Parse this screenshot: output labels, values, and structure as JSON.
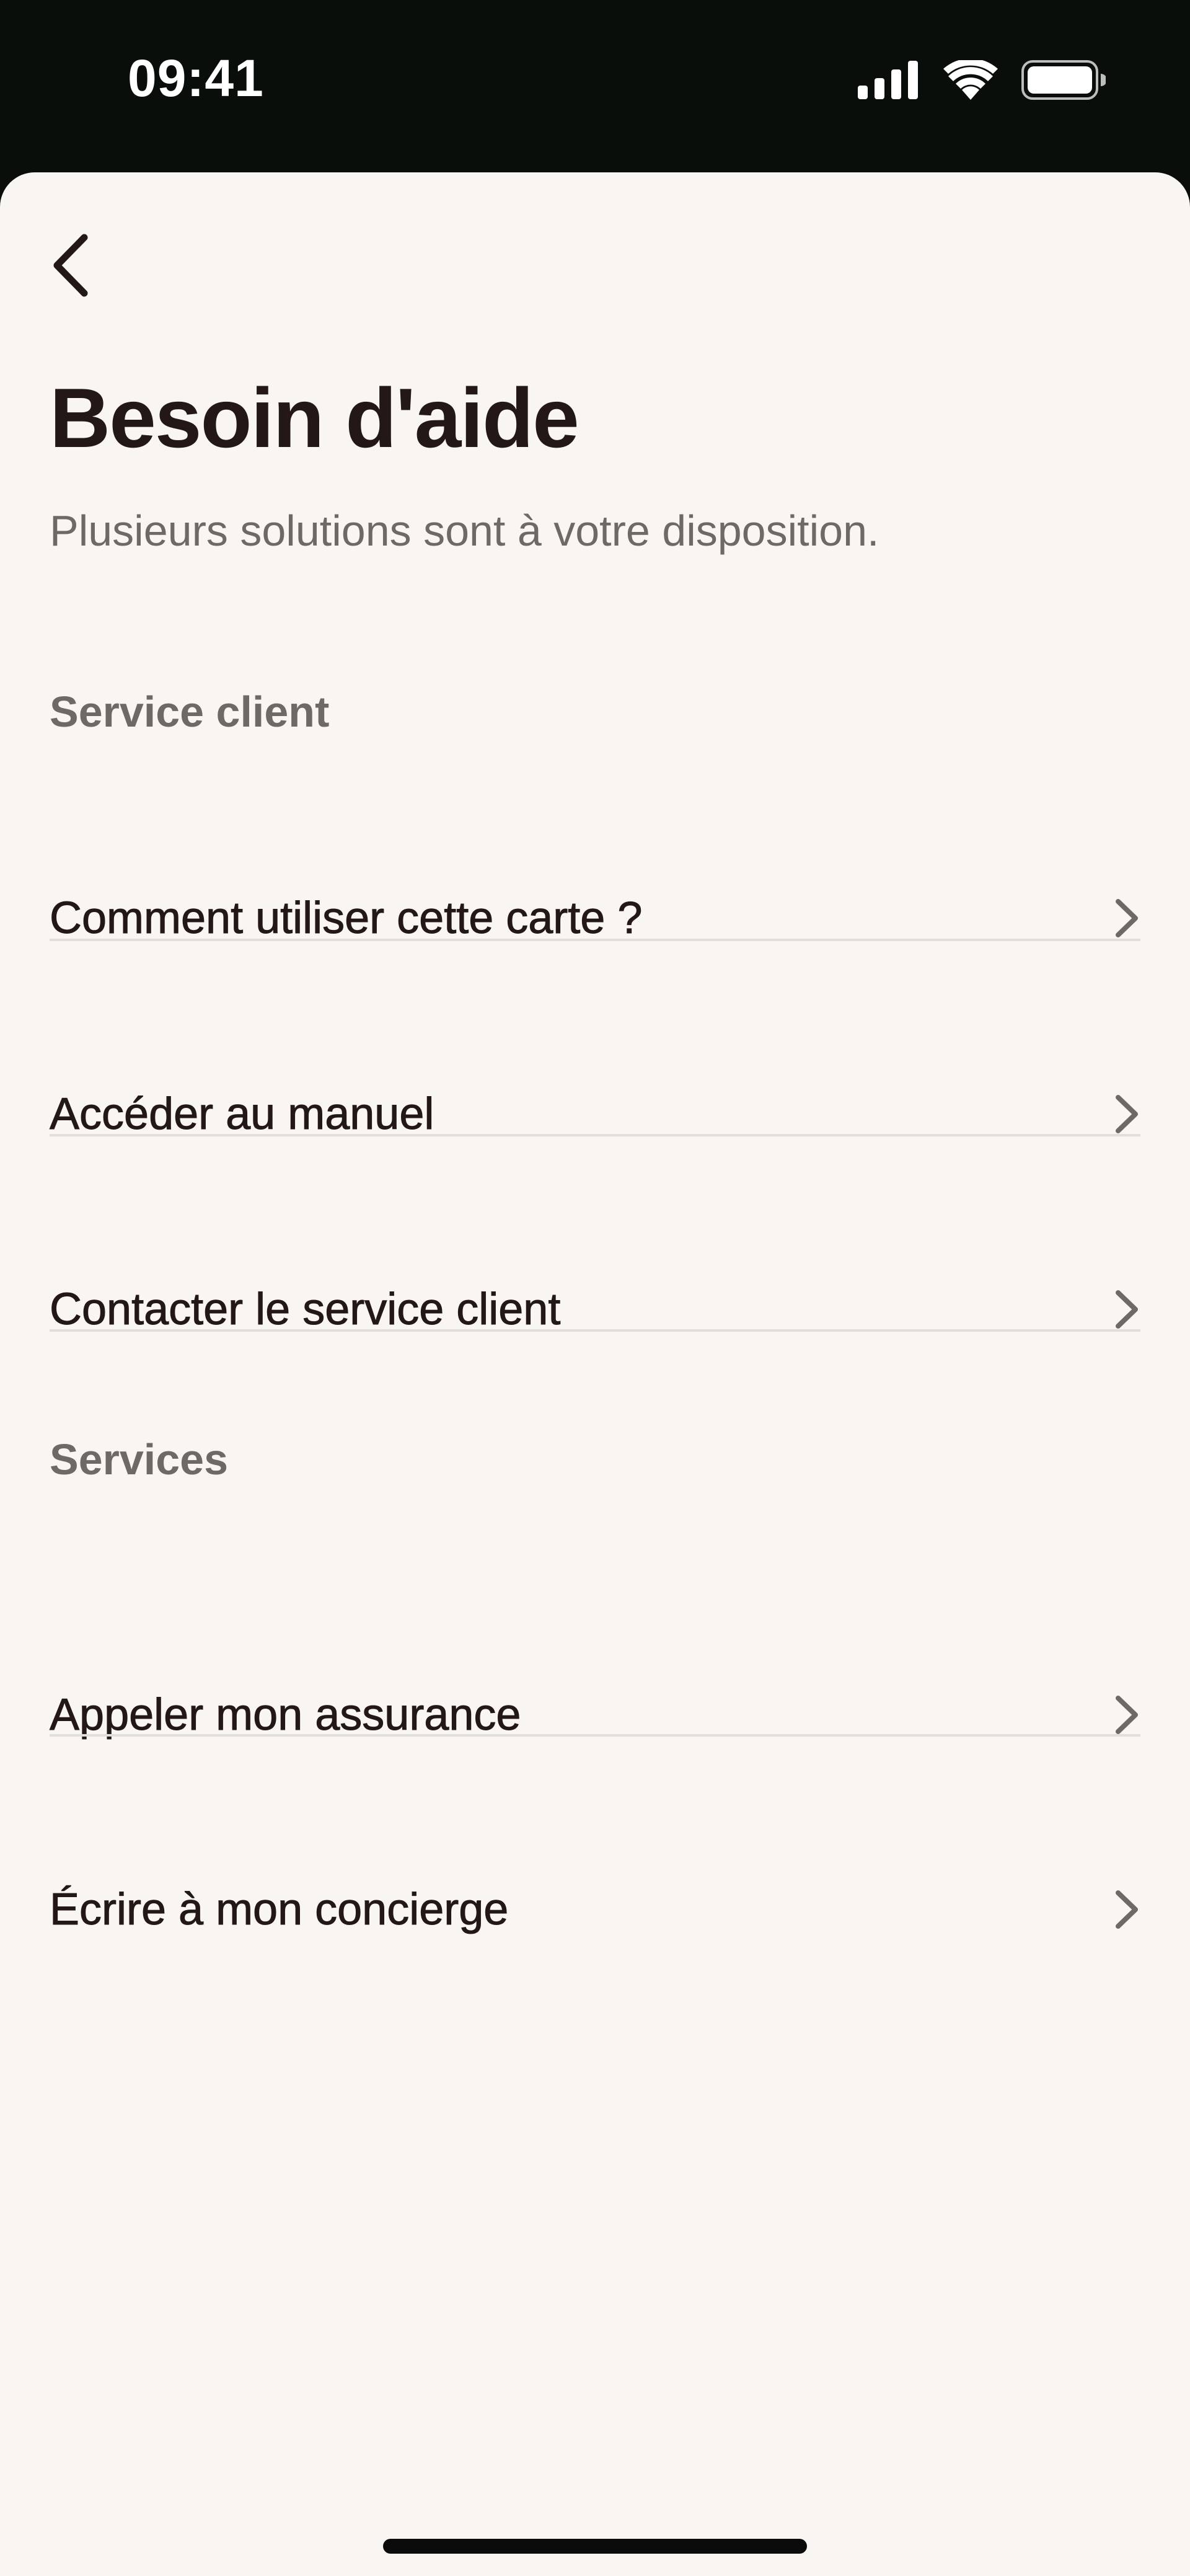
{
  "status_bar": {
    "time": "09:41",
    "icons": [
      "cellular-signal-icon",
      "wifi-icon",
      "battery-icon"
    ]
  },
  "header": {
    "back_icon": "chevron-left-icon",
    "title": "Besoin d'aide",
    "subtitle": "Plusieurs solutions sont à votre disposition."
  },
  "sections": [
    {
      "title": "Service client",
      "items": [
        {
          "label": "Comment utiliser cette carte ?"
        },
        {
          "label": "Accéder au manuel"
        },
        {
          "label": "Contacter le service client"
        }
      ]
    },
    {
      "title": "Services",
      "items": [
        {
          "label": "Appeler mon assurance"
        },
        {
          "label": "Écrire à mon concierge"
        }
      ]
    }
  ],
  "colors": {
    "status_bar_bg": "#0a0e0b",
    "sheet_bg": "#f8f5f2",
    "text_primary": "#231815",
    "text_secondary": "#6e6866",
    "divider": "#e2dedb",
    "chevron": "#6e6866"
  }
}
